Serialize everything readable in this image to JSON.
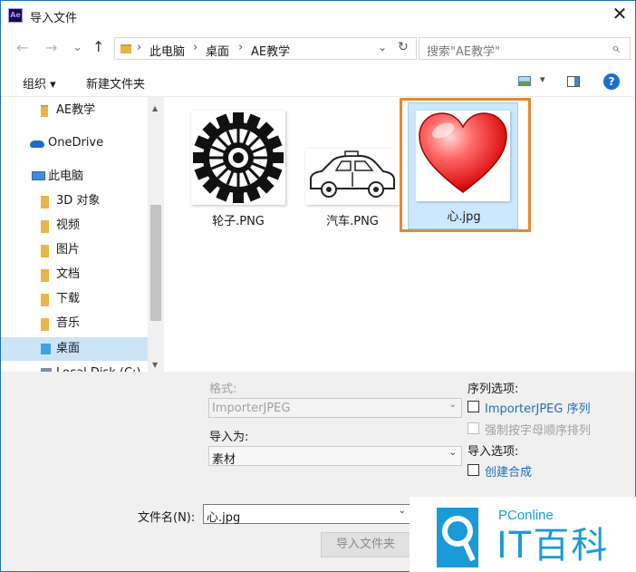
{
  "window": {
    "title": "导入文件",
    "app_logo_text": "Ae",
    "close_glyph": "✕"
  },
  "nav_controls": {
    "back": "←",
    "forward": "→",
    "dropdown": "⌄",
    "up": "↑"
  },
  "address": {
    "crumbs": [
      "此电脑",
      "桌面",
      "AE教学"
    ],
    "separator": "›",
    "dropdown": "⌄",
    "refresh": "↻"
  },
  "search": {
    "placeholder": "搜索\"AE教学\"",
    "icon": "⌕"
  },
  "toolbar": {
    "organize": "组织 ▾",
    "new_folder": "新建文件夹",
    "view_dropdown": "▾",
    "help": "?"
  },
  "sidebar": {
    "items": [
      {
        "label": "AE教学",
        "icon": "folder-icon"
      },
      {
        "label": "OneDrive",
        "icon": "cloud-icon"
      },
      {
        "label": "此电脑",
        "icon": "computer-icon"
      },
      {
        "label": "3D 对象",
        "icon": "cube-icon"
      },
      {
        "label": "视频",
        "icon": "video-icon"
      },
      {
        "label": "图片",
        "icon": "picture-icon"
      },
      {
        "label": "文档",
        "icon": "document-icon"
      },
      {
        "label": "下载",
        "icon": "download-icon"
      },
      {
        "label": "音乐",
        "icon": "music-icon"
      },
      {
        "label": "桌面",
        "icon": "desktop-icon",
        "selected": true
      },
      {
        "label": "Local Disk (C:)",
        "icon": "disk-icon"
      }
    ],
    "scroll_up": "▲",
    "scroll_down": "▼"
  },
  "files": [
    {
      "name": "轮子.PNG",
      "icon": "gear-icon"
    },
    {
      "name": "汽车.PNG",
      "icon": "car-icon"
    },
    {
      "name": "心.jpg",
      "icon": "heart-icon",
      "selected": true
    }
  ],
  "options": {
    "format_label": "格式:",
    "format_value": "ImporterJPEG",
    "import_as_label": "导入为:",
    "import_as_value": "素材",
    "combo_arrow": "⌄",
    "sequence_title": "序列选项:",
    "sequence_checkbox": "ImporterJPEG 序列",
    "force_alpha": "强制按字母顺序排列",
    "import_options_title": "导入选项:",
    "create_comp": "创建合成"
  },
  "filename": {
    "label": "文件名(N):",
    "value": "心.jpg",
    "dropdown": "⌄"
  },
  "buttons": {
    "import_folder": "导入文件夹"
  },
  "watermark": {
    "brand": "PConline",
    "title": "IT百科"
  },
  "colors": {
    "accent": "#1e73b8",
    "selection": "#cce8ff",
    "highlight_frame": "#e8892b",
    "link": "#1f6fb8"
  }
}
